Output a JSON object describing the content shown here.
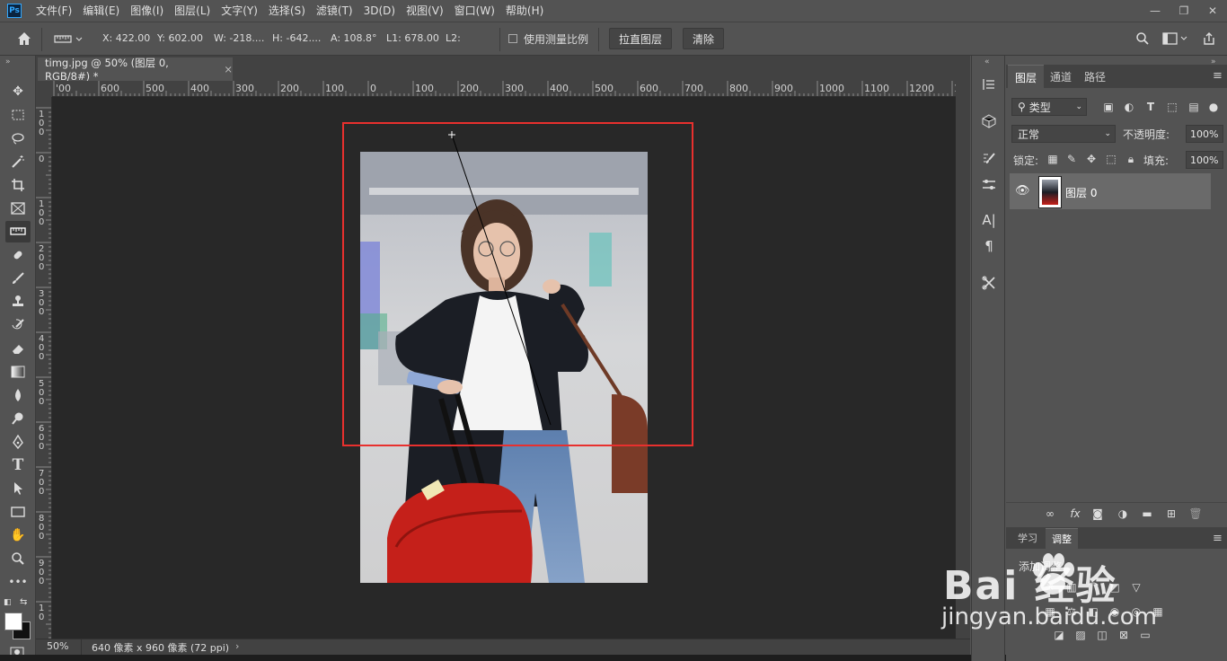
{
  "app": {
    "logo": "Ps"
  },
  "menu": [
    "文件(F)",
    "编辑(E)",
    "图像(I)",
    "图层(L)",
    "文字(Y)",
    "选择(S)",
    "滤镜(T)",
    "3D(D)",
    "视图(V)",
    "窗口(W)",
    "帮助(H)"
  ],
  "window_controls": {
    "minimize": "—",
    "restore": "❐",
    "close": "✕"
  },
  "options": {
    "x": "X: 422.00",
    "y": "Y: 602.00",
    "w": "W: -218....",
    "h": "H: -642....",
    "a": "A: 108.8°",
    "l1": "L1: 678.00",
    "l2": "L2:",
    "use_scale_label": "使用测量比例",
    "straighten_button": "拉直图层",
    "clear_button": "清除"
  },
  "document": {
    "tab_title": "timg.jpg @ 50% (图层 0, RGB/8#) *",
    "tab_close": "×",
    "zoom": "50%",
    "doc_size": "640 像素 x 960 像素 (72 ppi)"
  },
  "ruler": {
    "h_labels": [
      "'00",
      "600",
      "500",
      "400",
      "300",
      "200",
      "100",
      "0",
      "100",
      "200",
      "300",
      "400",
      "500",
      "600",
      "700",
      "800",
      "900",
      "1000",
      "1100",
      "1200",
      "13"
    ],
    "v_labels": [
      "1\n0\n0",
      "0",
      "1\n0\n0",
      "2\n0\n0",
      "3\n0\n0",
      "4\n0\n0",
      "5\n0\n0",
      "6\n0\n0",
      "7\n0\n0",
      "8\n0\n0",
      "9\n0\n0",
      "1\n0"
    ]
  },
  "panels": {
    "tabs": [
      "图层",
      "通道",
      "路径"
    ],
    "filter_kind": "类型",
    "blend_mode": "正常",
    "opacity_label": "不透明度:",
    "opacity_value": "100%",
    "lock_label": "锁定:",
    "fill_label": "填充:",
    "fill_value": "100%",
    "layer_name": "图层 0",
    "bottom_tabs": [
      "学习",
      "调整"
    ],
    "add_adjustment": "添加调整"
  },
  "watermark": {
    "text": "Bai 经验",
    "sub": "jingyan.baidu.com"
  },
  "colors": {
    "accent": "#31a8ff",
    "annotation": "#e8302e"
  }
}
